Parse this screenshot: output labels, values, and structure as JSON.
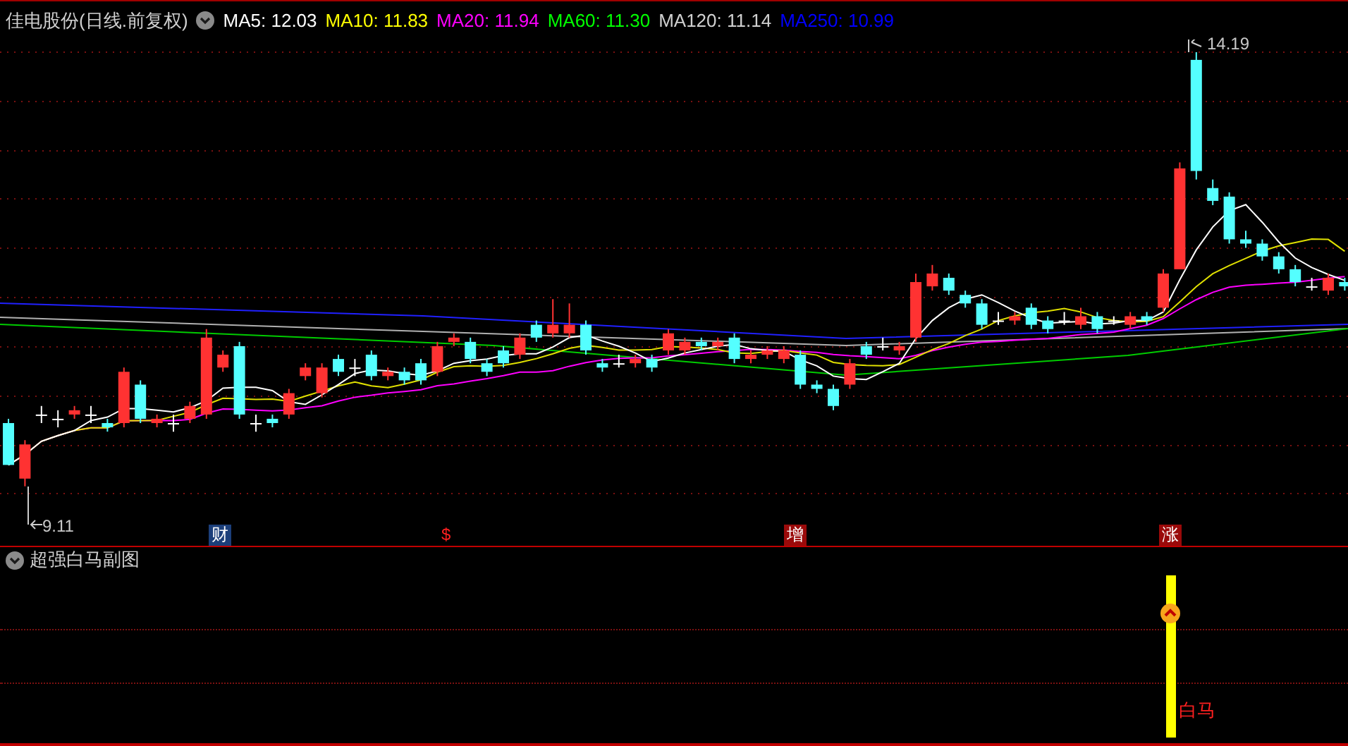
{
  "header": {
    "title": "佳电股份(日线.前复权)",
    "indicators": [
      {
        "label": "MA5: 12.03",
        "color": "#ffffff"
      },
      {
        "label": "MA10: 11.83",
        "color": "#ffff00"
      },
      {
        "label": "MA20: 11.94",
        "color": "#ff00ff"
      },
      {
        "label": "MA60: 11.30",
        "color": "#00ff00"
      },
      {
        "label": "MA120: 11.14",
        "color": "#d0d0d0"
      },
      {
        "label": "MA250: 10.99",
        "color": "#0000ff"
      }
    ]
  },
  "price_labels": {
    "high": "14.19",
    "low": "9.11"
  },
  "event_markers": [
    {
      "label": "财",
      "kind": "boxed",
      "color": "#1c3f7a"
    },
    {
      "label": "$",
      "kind": "plain",
      "color": "#ff2020"
    },
    {
      "label": "增",
      "kind": "boxed",
      "color": "#9a0a0a"
    },
    {
      "label": "涨",
      "kind": "boxed",
      "color": "#9a0a0a"
    }
  ],
  "sub_panel": {
    "title": "超强白马副图",
    "signal_label": "白马"
  }
}
